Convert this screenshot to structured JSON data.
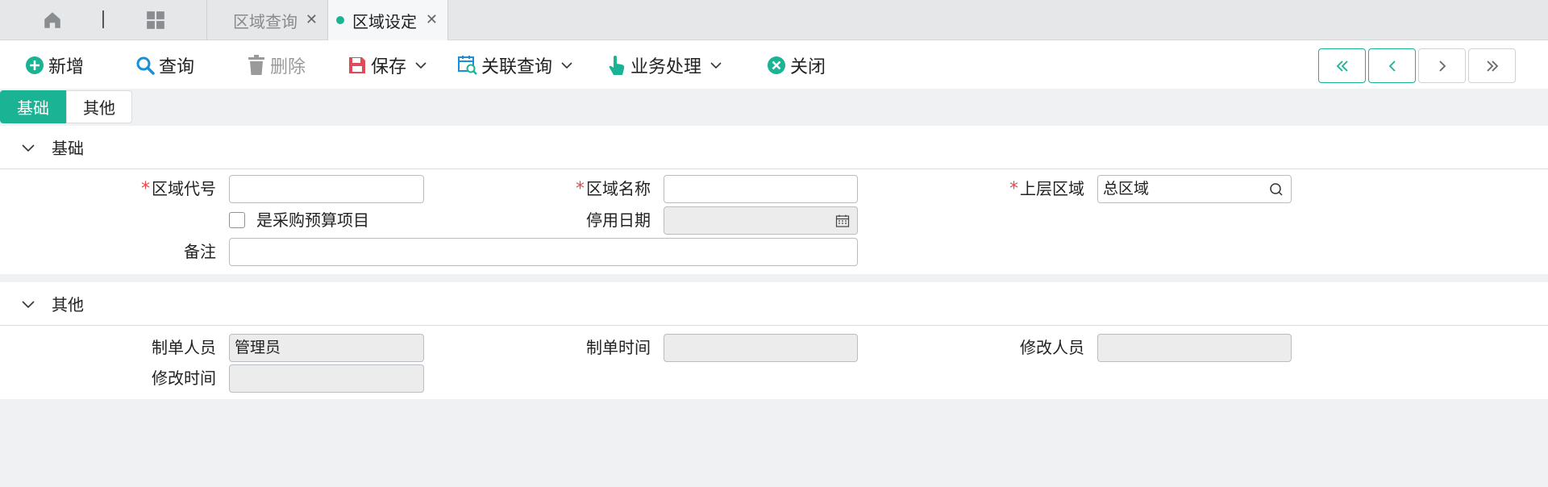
{
  "tabs": [
    {
      "label": "区域查询"
    },
    {
      "label": "区域设定"
    }
  ],
  "toolbar": {
    "new_label": "新增",
    "query_label": "查询",
    "delete_label": "删除",
    "save_label": "保存",
    "related_query_label": "关联查询",
    "business_label": "业务处理",
    "close_label": "关闭"
  },
  "form_tabs": [
    {
      "label": "基础"
    },
    {
      "label": "其他"
    }
  ],
  "section_base": {
    "title": "基础",
    "region_code_label": "区域代号",
    "region_code_value": "",
    "region_name_label": "区域名称",
    "region_name_value": "",
    "parent_region_label": "上层区域",
    "parent_region_value": "总区域",
    "purchase_budget_label": "是采购预算项目",
    "disable_date_label": "停用日期",
    "disable_date_value": "",
    "remark_label": "备注",
    "remark_value": "",
    "required_mark": "*"
  },
  "section_other": {
    "title": "其他",
    "creator_label": "制单人员",
    "creator_value": "管理员",
    "create_time_label": "制单时间",
    "create_time_value": "",
    "modifier_label": "修改人员",
    "modifier_value": "",
    "modify_time_label": "修改时间",
    "modify_time_value": ""
  },
  "colors": {
    "accent": "#1ab394",
    "required": "#e24b4b",
    "disabled_text": "#9a9a9a",
    "save_icon": "#e04b5a",
    "close_icon": "#1ab394"
  },
  "icons": {
    "home": "home-icon",
    "grid": "grid-icon",
    "new": "plus-circle-icon",
    "query": "search-icon",
    "delete": "trash-icon",
    "save": "floppy-icon",
    "related": "calendar-search-icon",
    "business": "pointer-hand-icon",
    "close": "x-circle-icon"
  }
}
